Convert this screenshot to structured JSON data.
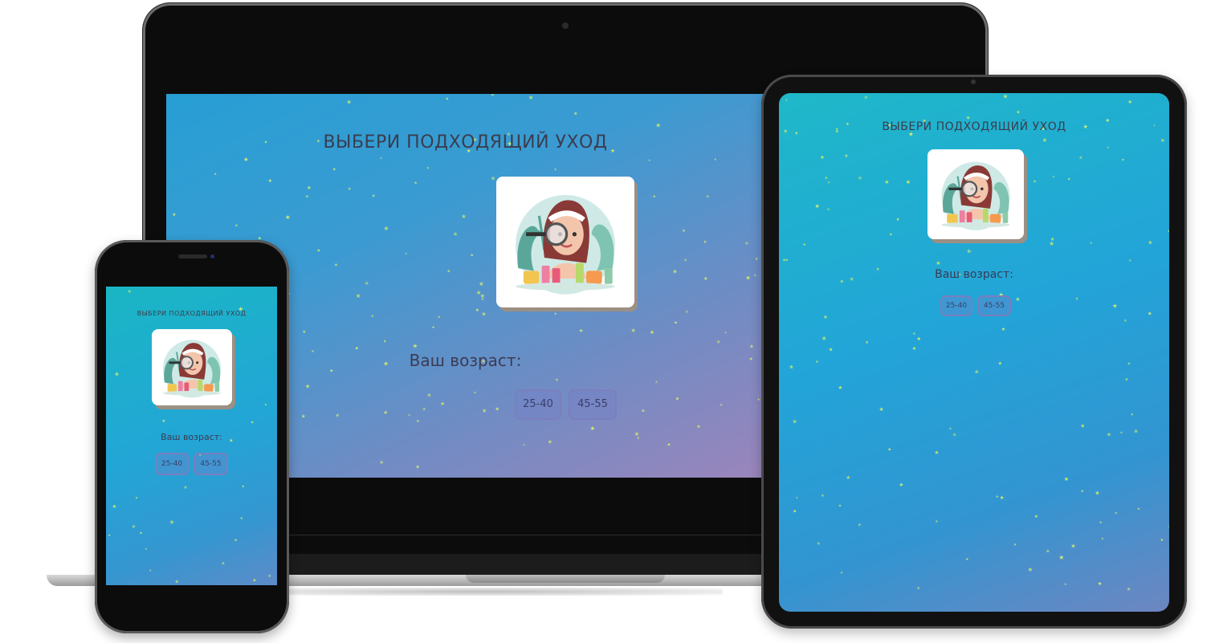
{
  "page": {
    "title": "ВЫБЕРИ ПОДХОДЯЩИЙ УХОД",
    "age_label": "Ваш возраст:",
    "age_options": [
      "25-40",
      "45-55"
    ],
    "illustration_icon": "woman-skincare-illustration"
  },
  "colors": {
    "gradient_start": "#1fb8c9",
    "gradient_mid": "#22a4d8",
    "gradient_end": "#9a85bb",
    "button_border": "#7a7fbf",
    "title": "#3c3c4e",
    "star": "#d9ef6a"
  }
}
